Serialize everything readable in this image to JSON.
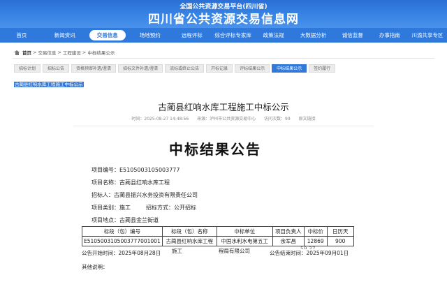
{
  "header": {
    "subtitle": "全国公共资源交易平台(四川省)",
    "title": "四川省公共资源交易信息网"
  },
  "nav": [
    {
      "label": "首页",
      "name": "nav-home",
      "w": 64
    },
    {
      "label": "新闻资讯",
      "name": "nav-news",
      "w": 64
    },
    {
      "label": "交易信息",
      "name": "nav-trade-info",
      "w": 54,
      "active": true
    },
    {
      "label": "场地预约",
      "name": "nav-venue",
      "w": 64
    },
    {
      "label": "远程评标",
      "name": "nav-remote-eval",
      "w": 60
    },
    {
      "label": "综合评标专家库",
      "name": "nav-experts",
      "w": 62
    },
    {
      "label": "政策法规",
      "name": "nav-policy",
      "w": 58
    },
    {
      "label": "大数据分析",
      "name": "nav-bigdata",
      "w": 60
    },
    {
      "label": "诚信监督",
      "name": "nav-integrity",
      "w": 56
    },
    {
      "label": "办事指南",
      "name": "nav-guide",
      "w": 54
    },
    {
      "label": "川渝共享专区",
      "name": "nav-chuanyu",
      "w": 58
    }
  ],
  "breadcrumb": [
    "首页",
    ">",
    "交易信息",
    ">",
    "工程建设",
    ">",
    "中标结果公示"
  ],
  "tabs": [
    {
      "label": "招标计划"
    },
    {
      "label": "招标公告"
    },
    {
      "label": "资格预审补遗/澄清"
    },
    {
      "label": "招标文件补遗/澄清"
    },
    {
      "label": "流标或终止公告"
    },
    {
      "label": "开标记录"
    },
    {
      "label": "评标结果公示"
    },
    {
      "label": "中标结果公示",
      "active": true
    },
    {
      "label": "签约履行"
    }
  ],
  "selected_text": "古蔺县红响水库工程施工中标公示",
  "article": {
    "title": "古蔺县红响水库工程施工中标公示",
    "time": "时间：2025-08-27 14:48:56",
    "source": "来源：泸州市公共资源交易中心",
    "views": "访问次数：99",
    "action": "原文链接"
  },
  "notice": {
    "heading": "中标结果公告",
    "project_no": "项目编号：E5105003105003777",
    "project_name": "项目名称：古蔺县红响水库工程",
    "tenderer": "招标人：古蔺县振兴水务投资有限责任公司",
    "category": "项目类别：施工",
    "method": "招标方式：公开招标",
    "location": "项目地点：古蔺县金兰街道",
    "table_headers": [
      "标段（包）编号",
      "标段（包）名称",
      "中标单位",
      "项目负责人",
      "中标价",
      "日历天"
    ],
    "table_row": [
      "E5105003105003777001001",
      "古蔺县红响水库工程",
      "中国水利水电第五工",
      "余军昌",
      "12869",
      "900"
    ],
    "overflow_name": "施工",
    "overflow_unit": "程局有限公司",
    "overflow_price": "59.37",
    "start": "公告开始时间：2025年08月28日",
    "end": "公告结束时间：2025年09月01日",
    "other": "其他说明："
  }
}
